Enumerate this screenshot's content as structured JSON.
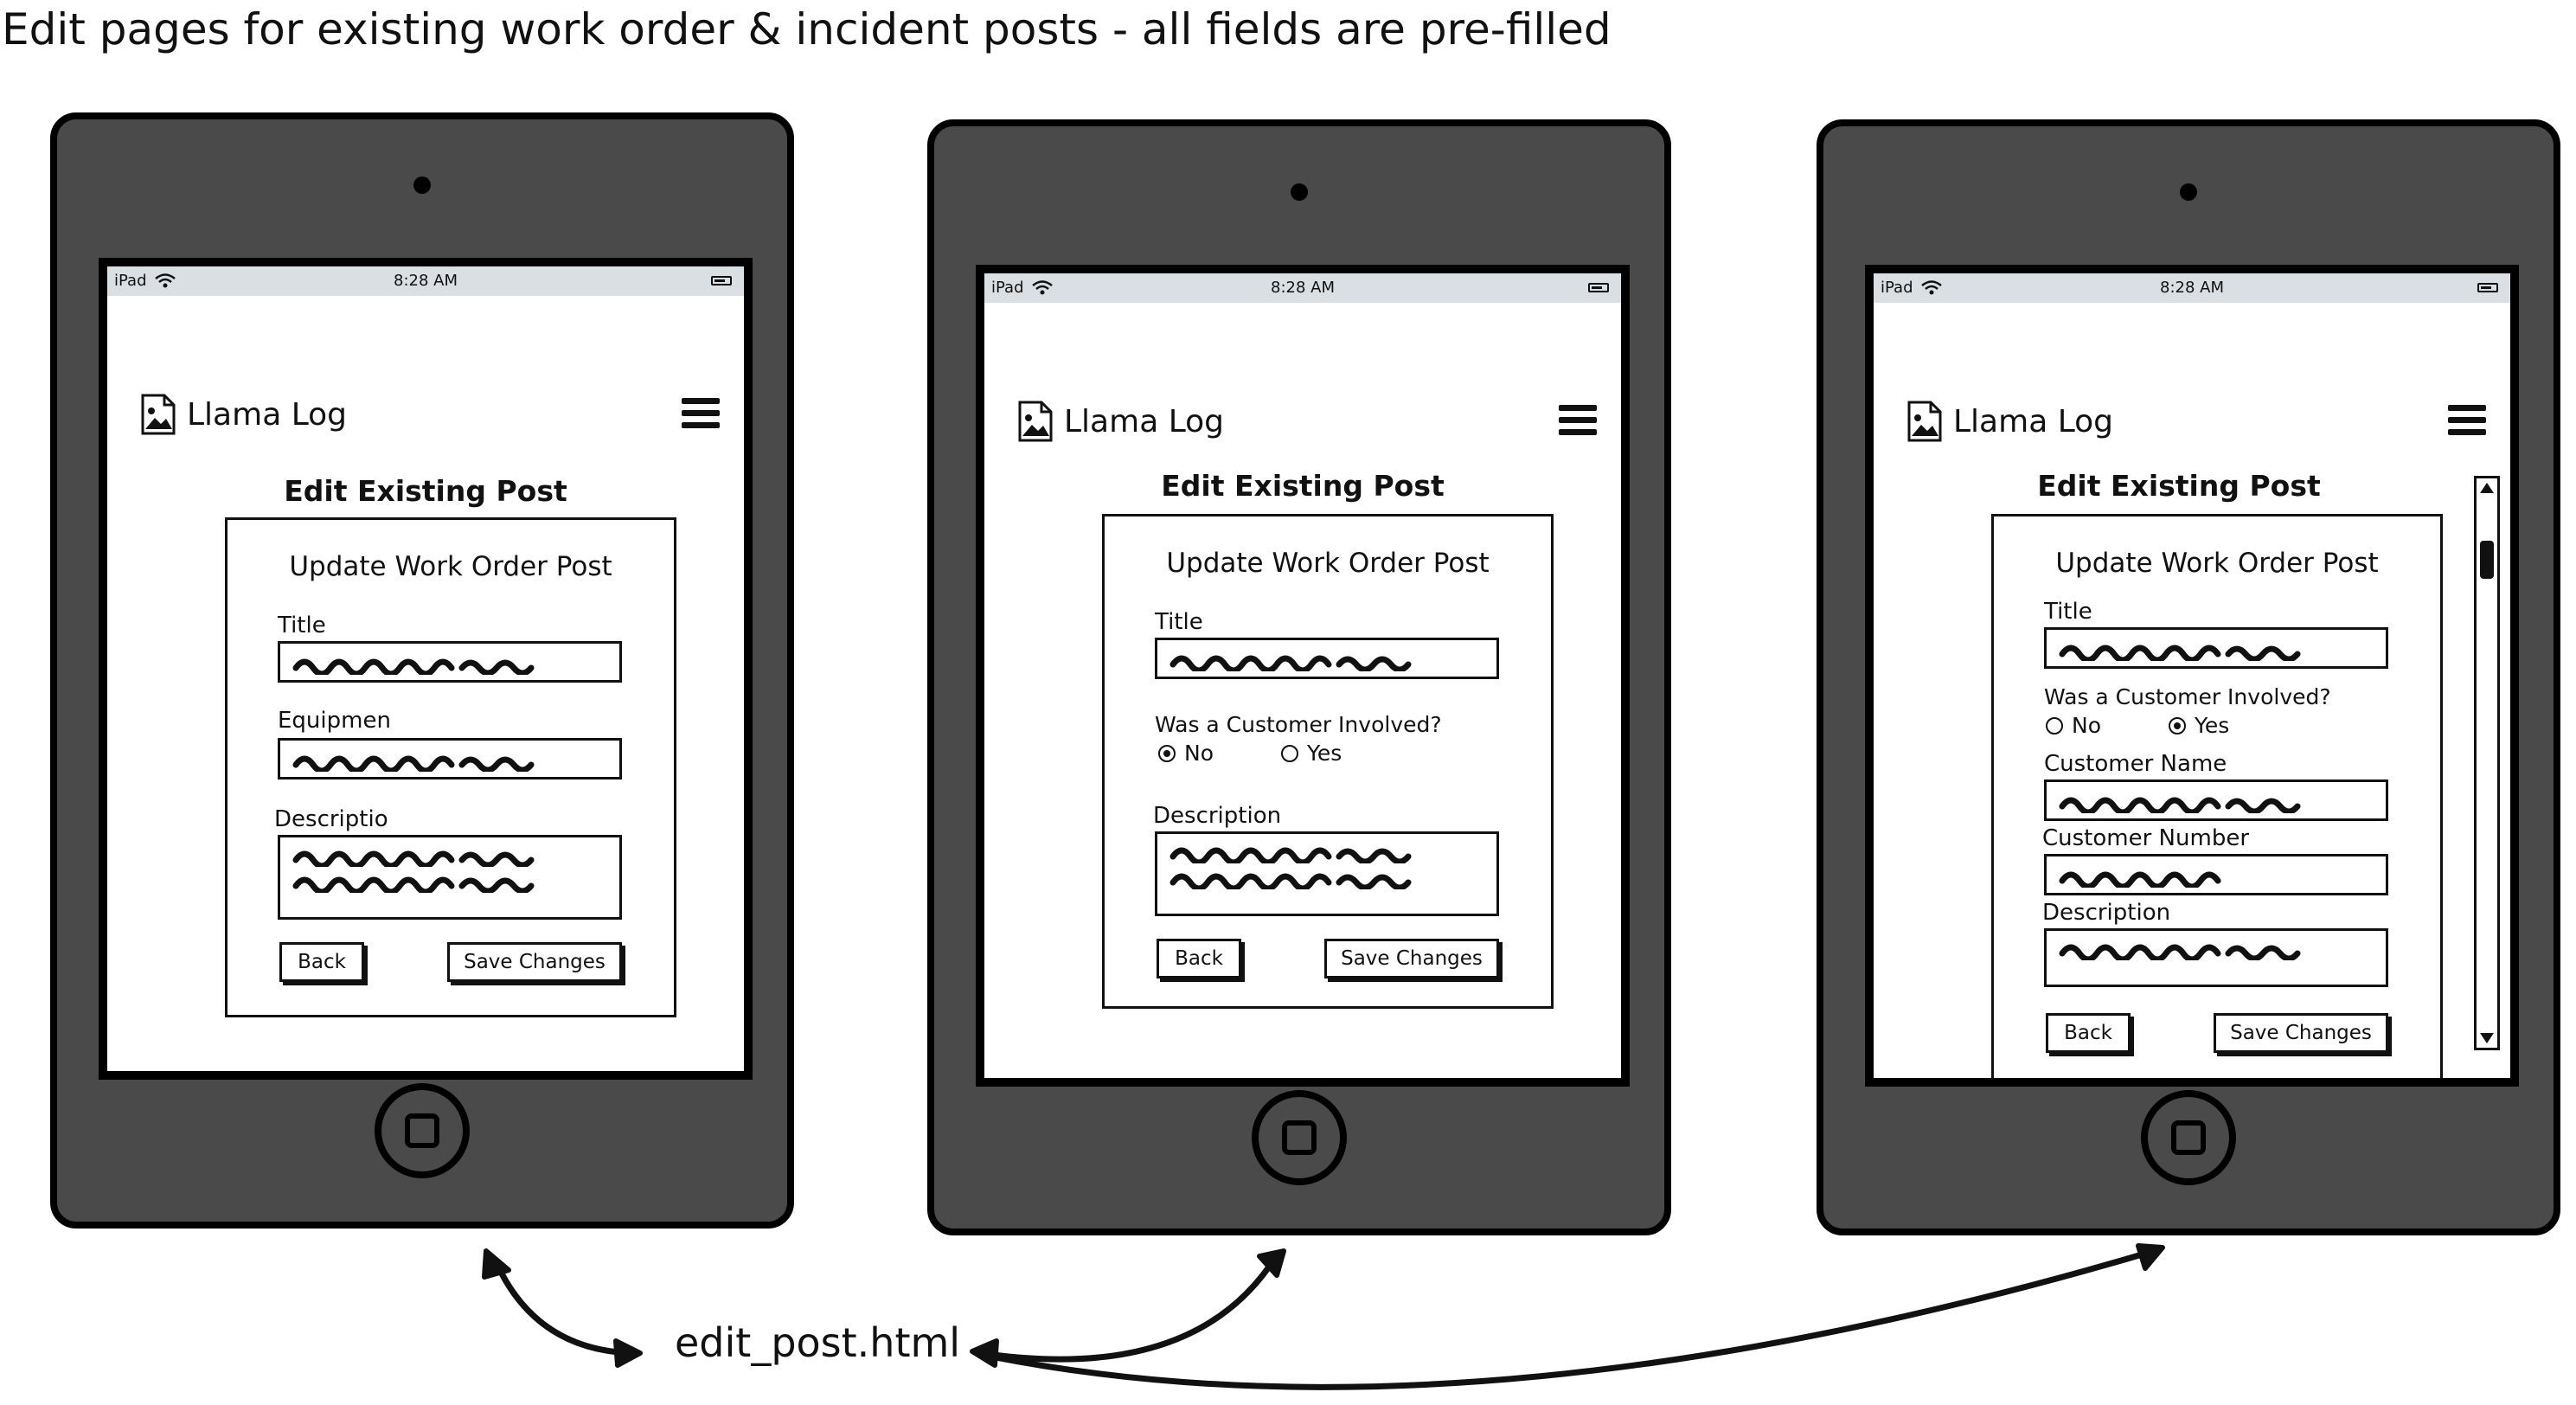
{
  "heading": "Edit pages for existing work order & incident posts - all fields are pre-filled",
  "status_bar": {
    "device": "iPad",
    "time": "8:28 AM"
  },
  "app": {
    "name": "Llama Log"
  },
  "screens": [
    {
      "page_title": "Edit Existing Post",
      "card_title": "Update Work Order Post",
      "labels": {
        "title": "Title",
        "equipment": "Equipmen",
        "description": "Descriptio"
      },
      "buttons": {
        "back": "Back",
        "save": "Save Changes"
      }
    },
    {
      "page_title": "Edit Existing Post",
      "card_title": "Update Work Order Post",
      "labels": {
        "title": "Title",
        "customer_question": "Was a Customer Involved?",
        "description": "Description"
      },
      "radio": {
        "no": "No",
        "yes": "Yes",
        "selected": "No"
      },
      "buttons": {
        "back": "Back",
        "save": "Save Changes"
      }
    },
    {
      "page_title": "Edit Existing Post",
      "card_title": "Update Work Order Post",
      "labels": {
        "title": "Title",
        "customer_question": "Was a Customer Involved?",
        "customer_name": "Customer Name",
        "customer_number": "Customer Number",
        "description": "Description"
      },
      "radio": {
        "no": "No",
        "yes": "Yes",
        "selected": "Yes"
      },
      "buttons": {
        "back": "Back",
        "save": "Save Changes"
      }
    }
  ],
  "link_label": "edit_post.html",
  "icons": [
    "wifi-icon",
    "battery-icon",
    "image-file-icon",
    "hamburger-menu-icon",
    "home-button-icon",
    "scroll-up-icon",
    "scroll-down-icon",
    "curved-arrow-icon"
  ]
}
